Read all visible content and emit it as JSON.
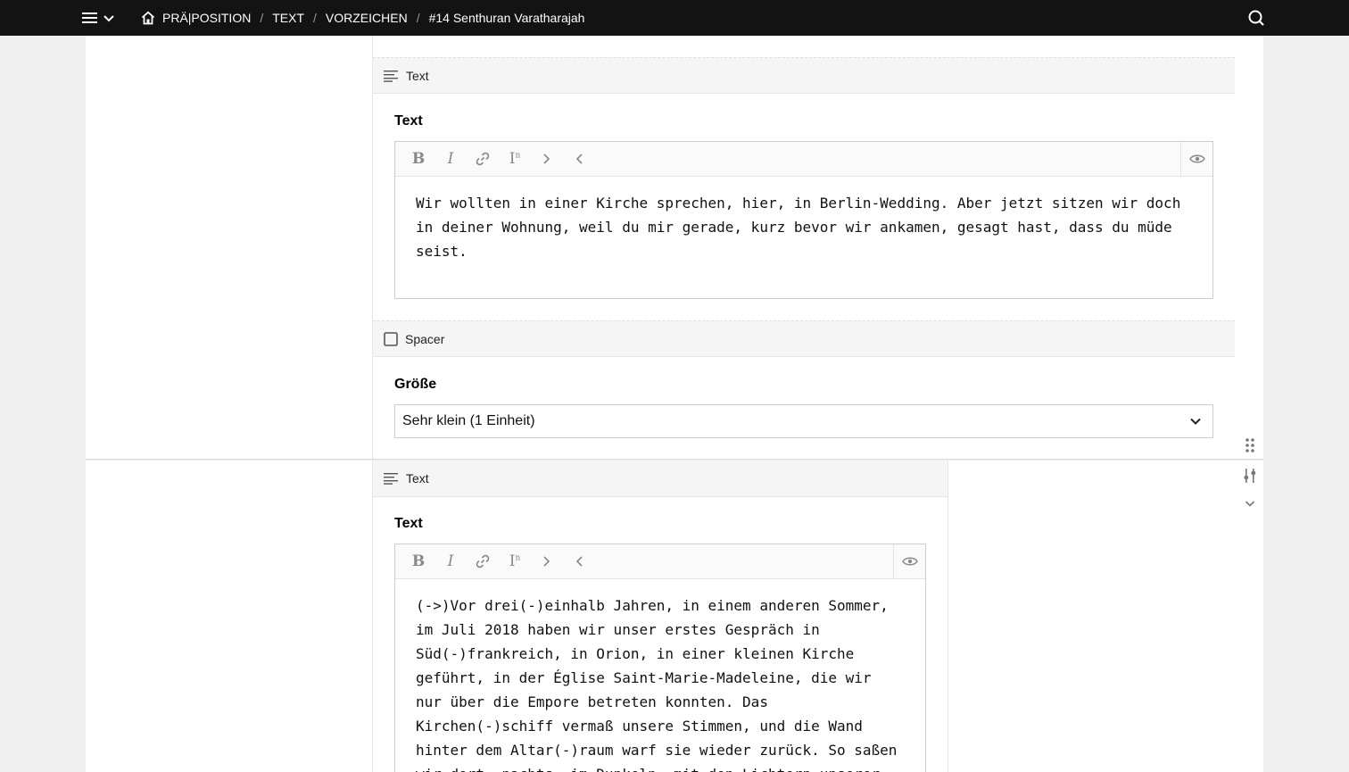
{
  "topbar": {
    "breadcrumbs": [
      "PRÄ|POSITION",
      "TEXT",
      "VORZEICHEN",
      "#14 Senthuran Varatharajah"
    ],
    "separator": "/"
  },
  "blocks": {
    "text1": {
      "header": "Text",
      "label": "Text",
      "content": "Wir wollten in einer Kirche sprechen, hier, in Berlin-Wedding. Aber jetzt sitzen wir doch in deiner Wohnung, weil du mir gerade, kurz bevor wir ankamen, gesagt hast, dass du müde seist."
    },
    "spacer": {
      "header": "Spacer",
      "label": "Größe",
      "selected": "Sehr klein (1 Einheit)"
    },
    "text2": {
      "header": "Text",
      "label": "Text",
      "content": "(->)Vor drei(-)einhalb Jahren, in einem anderen Sommer, im Juli 2018 haben wir unser erstes Gespräch in Süd(-)frankreich, in Orion, in einer kleinen Kirche geführt, in der Église Saint-Marie-Madeleine, die wir nur über die Empore betreten konnten. Das Kirchen(-)schiff vermaß unsere Stimmen, und die Wand hinter dem Altar(-)raum warf sie wieder zurück. So saßen wir dort, nachts, im Dunkeln, mit den Lichtern unserer"
    }
  },
  "icons": {
    "menu": "hamburger-icon",
    "home": "home-icon",
    "search": "search-icon",
    "text_block": "text-lines-icon",
    "spacer_block": "square-icon",
    "bold": "bold-icon",
    "italic": "italic-icon",
    "link": "link-icon",
    "superscript": "superscript-icon",
    "indent": "chevron-right-icon",
    "outdent": "chevron-left-icon",
    "preview": "eye-icon",
    "drag": "drag-dots-icon",
    "settings": "sliders-icon",
    "collapse": "chevron-down-icon"
  }
}
